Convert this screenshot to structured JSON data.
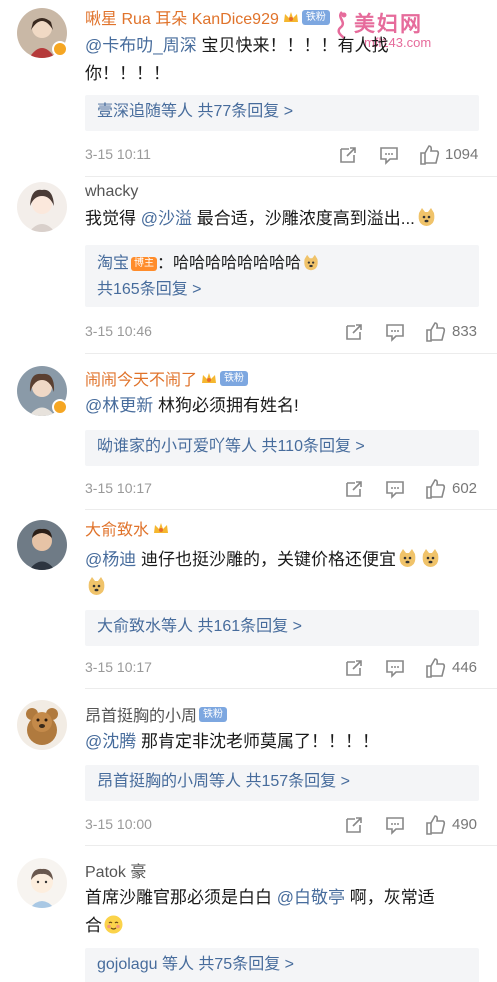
{
  "watermark": {
    "brand": "美妇网",
    "url": "mfl143.com"
  },
  "comments": [
    {
      "user": "啾星 Rua 耳朵 KanDice929",
      "fan_badge": "铁粉",
      "mention": "@卡布叻_周深",
      "text_line1": " 宝贝快来！！！！有人找",
      "text_line2": "你！！！！",
      "reply_summary_user": "壹深追随等人",
      "reply_summary_count": "共77条回复 >",
      "time": "3-15 10:11",
      "likes": "1094"
    },
    {
      "user": "whacky",
      "text_pre": "我觉得 ",
      "mention": "@沙溢",
      "text_post": "  最合适，沙雕浓度高到溢出...",
      "reply_author": "淘宝",
      "blogger_badge": "博主",
      "reply_text": "：哈哈哈哈哈哈哈哈",
      "reply_summary_count": "共165条回复 >",
      "time": "3-15 10:46",
      "likes": "833"
    },
    {
      "user": "闹闹今天不闹了",
      "fan_badge": "铁粉",
      "mention": "@林更新",
      "text": " 林狗必须拥有姓名!",
      "reply_summary_user": "呦谁家的小可爱吖等人",
      "reply_summary_count": "共110条回复 >",
      "time": "3-15 10:17",
      "likes": "602"
    },
    {
      "user": "大俞致水",
      "mention": "@杨迪",
      "text": "  迪仔也挺沙雕的，关键价格还便宜",
      "reply_summary_user": "大俞致水等人",
      "reply_summary_count": "共161条回复 >",
      "time": "3-15 10:17",
      "likes": "446"
    },
    {
      "user": "昂首挺胸的小周",
      "fan_badge": "铁粉",
      "mention": "@沈腾",
      "text": "  那肯定非沈老师莫属了！！！！",
      "reply_summary_user": "昂首挺胸的小周等人",
      "reply_summary_count": "共157条回复 >",
      "time": "3-15 10:00",
      "likes": "490"
    },
    {
      "user": "Patok 豪",
      "text_pre": "首席沙雕官那必须是白白 ",
      "mention": "@白敬亭",
      "text_post": "  啊，灰常适",
      "text_line2": "合",
      "reply_summary_user": "gojolagu 等人",
      "reply_summary_count": "共75条回复 >"
    }
  ],
  "colors": {
    "username": "#e0732b",
    "link": "#476c9c",
    "reply_bg": "#f4f5f7",
    "meta": "#999999"
  },
  "icons": [
    "share-icon",
    "comment-icon",
    "like-icon",
    "crown-icon",
    "doge-emoji",
    "blush-emoji"
  ]
}
